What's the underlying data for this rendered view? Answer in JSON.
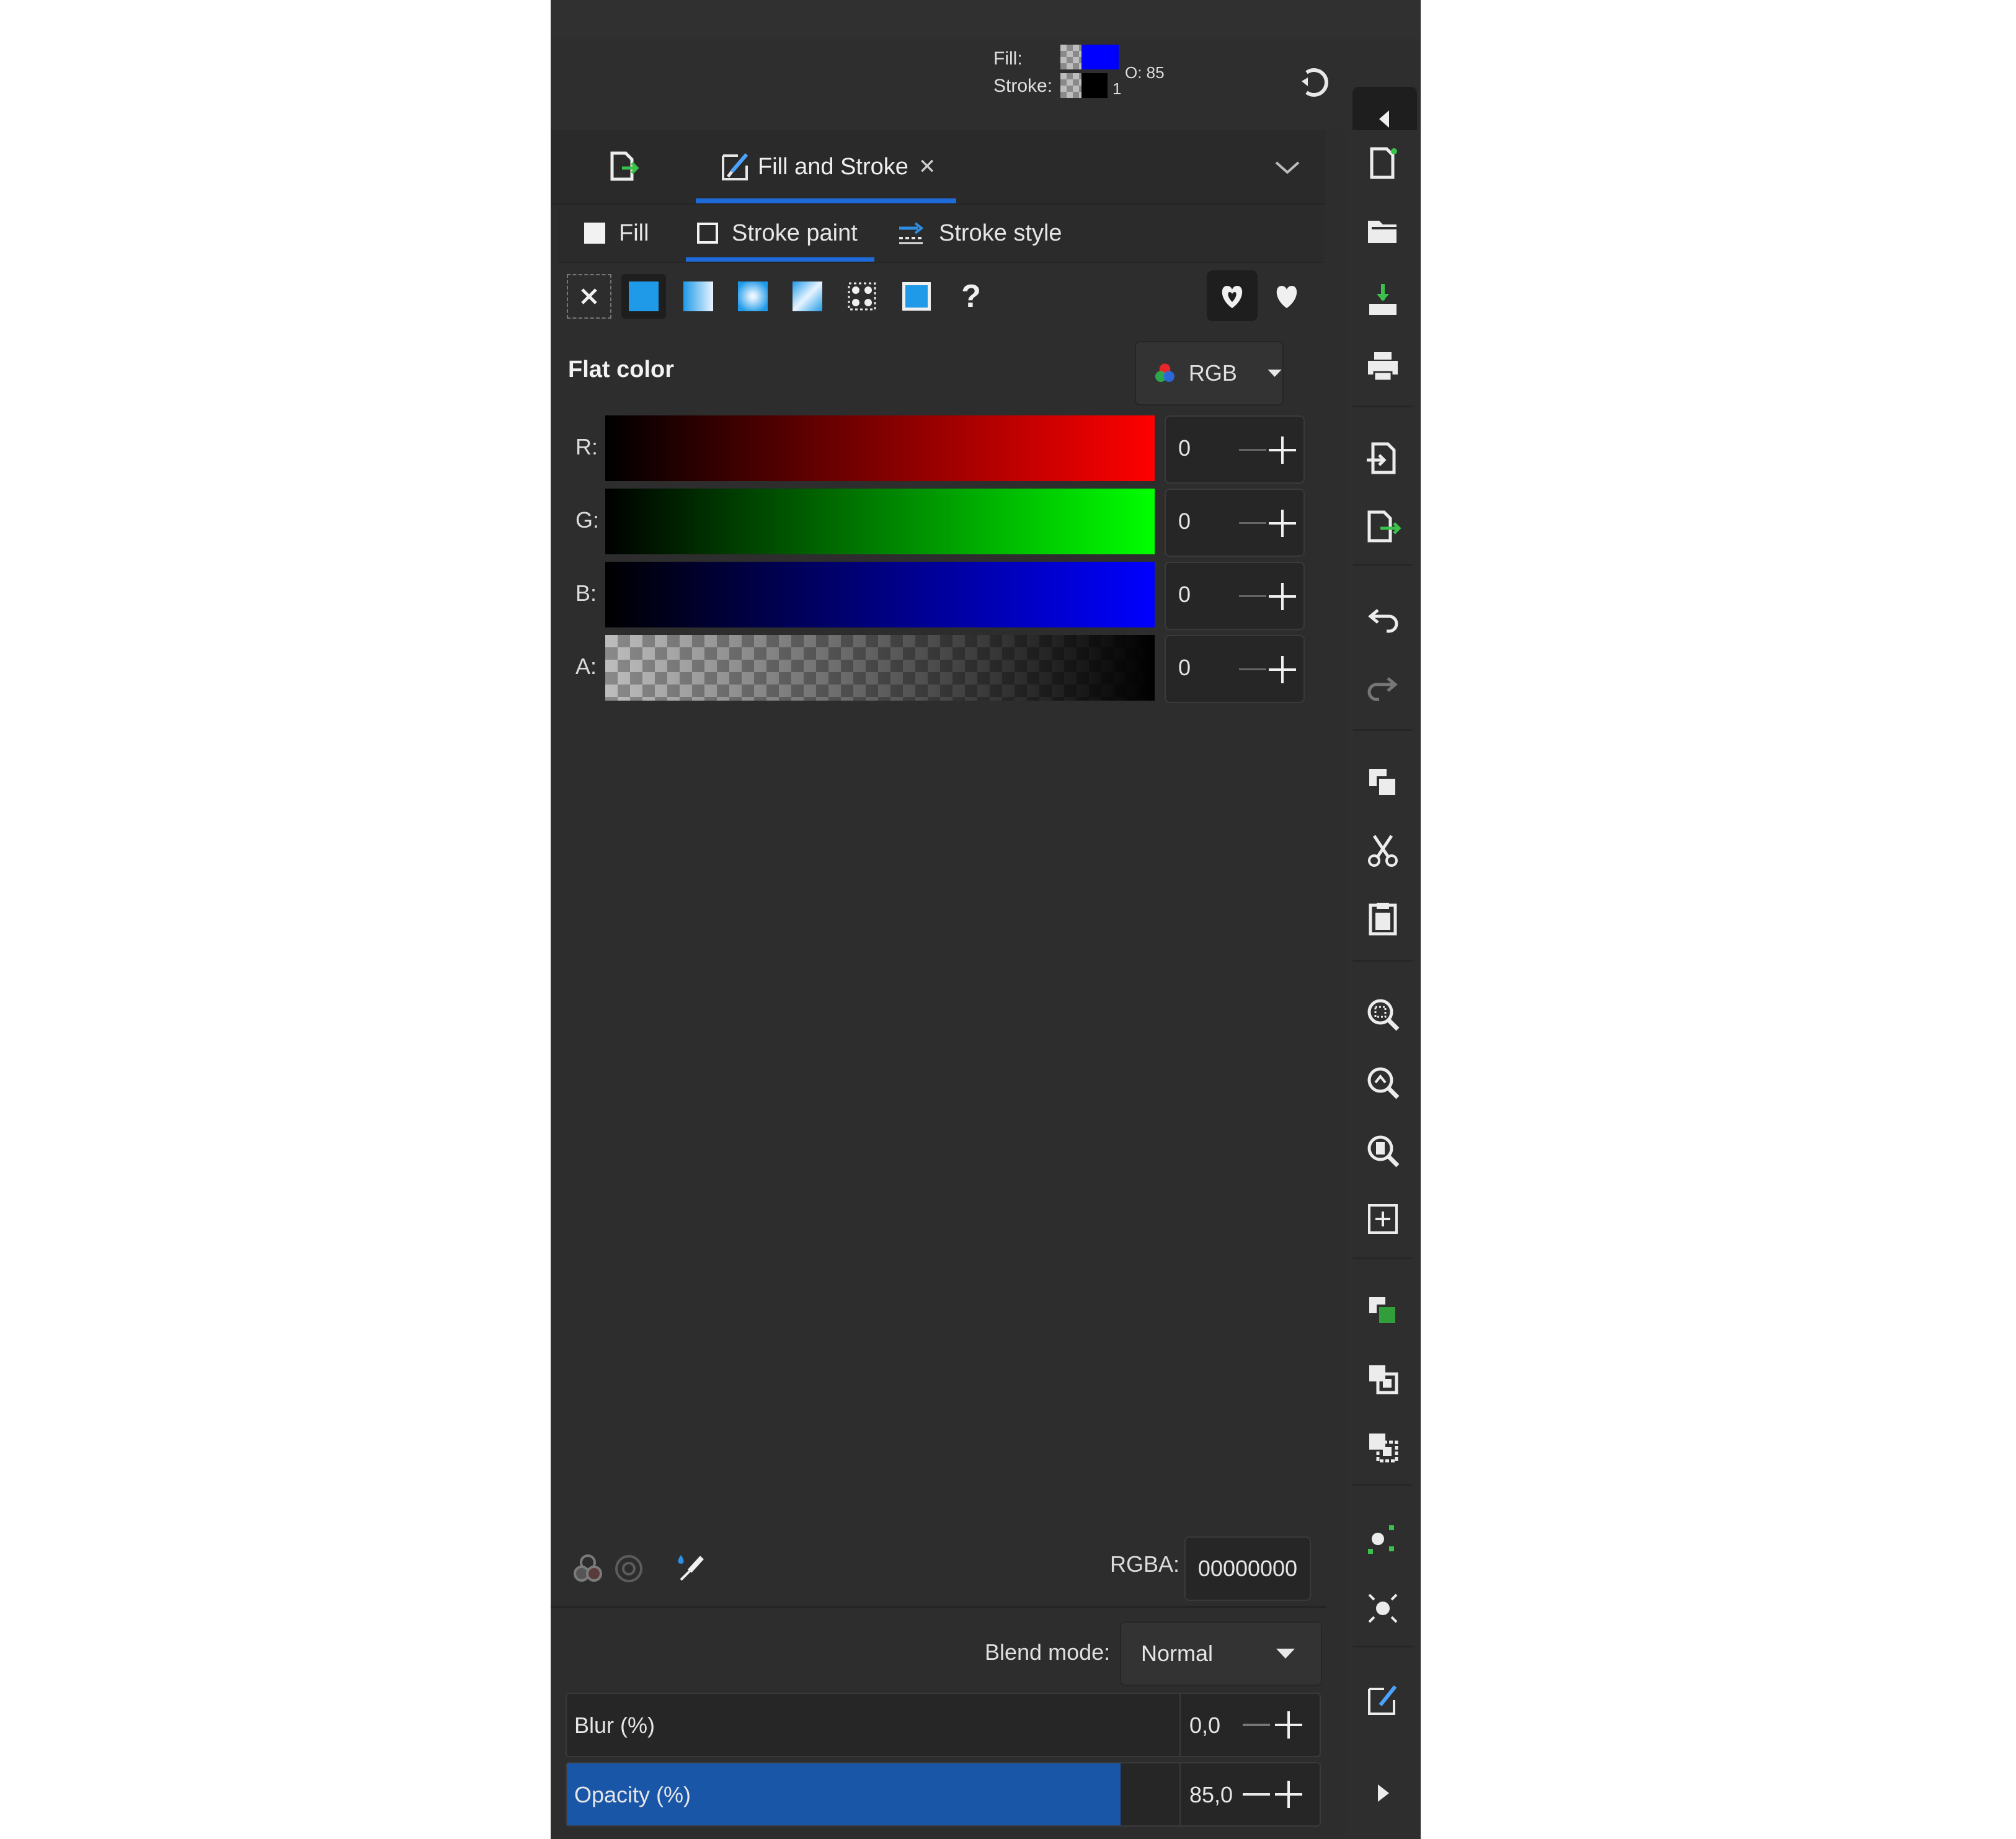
{
  "style_indicator": {
    "fill_label": "Fill:",
    "stroke_label": "Stroke:",
    "opacity_label": "O: 85",
    "stroke_width": "1",
    "fill_color": "#0000ff",
    "stroke_color": "#000000"
  },
  "dock": {
    "tabs": [
      {
        "label": "Fill and Stroke",
        "icon": "paint-brush-icon",
        "active": true
      }
    ],
    "close_glyph": "✕"
  },
  "subtabs": [
    {
      "label": "Fill",
      "icon": "fill-box-icon"
    },
    {
      "label": "Stroke paint",
      "icon": "stroke-box-icon",
      "active": true
    },
    {
      "label": "Stroke style",
      "icon": "stroke-style-icon"
    }
  ],
  "paint_types": [
    "no-paint",
    "flat-color",
    "linear-gradient",
    "radial-gradient",
    "mesh-gradient",
    "pattern",
    "swatch",
    "unset"
  ],
  "unset_glyph": "?",
  "flat_color_label": "Flat color",
  "color_mode": "RGB",
  "channels": [
    {
      "label": "R:",
      "value": "0",
      "from": "#000000",
      "to": "#ff0000"
    },
    {
      "label": "G:",
      "value": "0",
      "from": "#000000",
      "to": "#00ff00"
    },
    {
      "label": "B:",
      "value": "0",
      "from": "#000000",
      "to": "#0000ff"
    },
    {
      "label": "A:",
      "value": "0",
      "from": "transparent",
      "to": "#000000"
    }
  ],
  "rgba": {
    "label": "RGBA:",
    "value": "00000000"
  },
  "blend": {
    "label": "Blend mode:",
    "value": "Normal"
  },
  "blur": {
    "label": "Blur (%)",
    "value": "0,0",
    "fraction": 0.0
  },
  "opacity": {
    "label": "Opacity (%)",
    "value": "85,0",
    "fraction": 0.85
  },
  "accent_color": "#1d6ad8",
  "right_toolbar_icons": [
    "new-document-icon",
    "open-folder-icon",
    "save-icon",
    "print-icon",
    "import-icon",
    "export-icon",
    "undo-icon",
    "redo-icon",
    "copy-icon",
    "cut-icon",
    "paste-icon",
    "zoom-selection-icon",
    "zoom-drawing-icon",
    "zoom-page-icon",
    "zoom-center-icon",
    "duplicate-icon",
    "group-icon",
    "ungroup-icon",
    "node-tool-icon",
    "transform-icon",
    "fill-stroke-icon",
    "expand-right-icon"
  ]
}
